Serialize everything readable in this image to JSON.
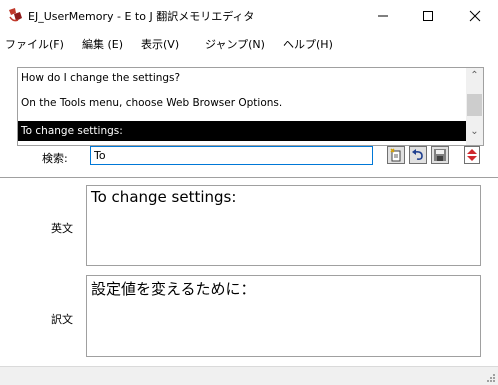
{
  "window": {
    "title": "EJ_UserMemory - E to J 翻訳メモリエディタ"
  },
  "icons": {
    "app": "translation-memory-icon",
    "minimize": "minimize-icon",
    "maximize": "maximize-icon",
    "close": "close-icon",
    "toolbar": [
      "new-entry-icon",
      "undo-icon",
      "save-icon",
      "up-down-spin-icon"
    ]
  },
  "menu": [
    {
      "label": "ファイル(F)"
    },
    {
      "label": "編集 (E)"
    },
    {
      "label": "表示(V)"
    },
    {
      "label": "ジャンプ(N)"
    },
    {
      "label": "ヘルプ(H)"
    }
  ],
  "list": {
    "items": [
      {
        "text": "How do I change the settings?",
        "selected": false
      },
      {
        "text": "On the Tools menu, choose Web Browser Options.",
        "selected": false
      },
      {
        "text": "To change settings:",
        "selected": true
      }
    ]
  },
  "search": {
    "label": "検索:",
    "value": "To"
  },
  "source": {
    "label": "英文",
    "text": "To change settings:"
  },
  "target": {
    "label": "訳文",
    "text": "設定値を変えるために："
  },
  "colors": {
    "focus": "#0078d7",
    "selection": "#000000",
    "border": "#a0a0a0"
  }
}
